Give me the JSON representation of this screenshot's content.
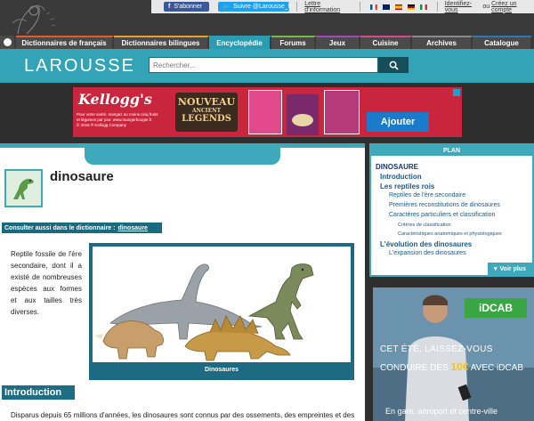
{
  "topbar": {
    "facebook_label": "S'abonner",
    "twitter_label": "Suivre @Larousse_fr",
    "newsletter_label": "Lettre d'information",
    "login_label": "Identifiez-vous",
    "or_label": "ou",
    "register_label": "Créez un compte"
  },
  "nav": {
    "items": [
      {
        "label": "Dictionnaires de français"
      },
      {
        "label": "Dictionnaires bilingues"
      },
      {
        "label": "Encyclopédie"
      },
      {
        "label": "Forums"
      },
      {
        "label": "Jeux"
      },
      {
        "label": "Cuisine"
      },
      {
        "label": "Archives"
      },
      {
        "label": "Catalogue"
      }
    ],
    "active_index": 2
  },
  "header": {
    "brand": "LAROUSSE",
    "search_placeholder": "Rechercher..."
  },
  "ad_banner": {
    "brand": "Kellogg's",
    "headline_1": "NOUVEAU",
    "headline_2": "ANCIENT",
    "headline_3": "LEGENDS",
    "small_text_1": "Pour votre santé, mangez au moins cinq fruits",
    "small_text_2": "et légumes par jour. www.mangerbouger.fr",
    "copyright": "© 2016 ® Kellogg Company",
    "cta": "Ajouter"
  },
  "article": {
    "title": "dinosaure",
    "see_also_label": "Consulter aussi dans le dictionnaire :",
    "see_also_link": "dinosaure",
    "lead": "Reptile fossile de l'ère secondaire, dont il a existé de nombreuses espèces aux formes et aux tailles très diverses.",
    "figure_caption": "Dinosaures",
    "section_heading": "Introduction",
    "body_start": "Disparus depuis 65 millions d'années, les dinosaures sont connus par des ossements, des empreintes et des"
  },
  "plan": {
    "heading": "PLAN",
    "items": [
      {
        "label": "DINOSAURE",
        "level": 0
      },
      {
        "label": "Introduction",
        "level": 1
      },
      {
        "label": "Les reptiles rois",
        "level": 1
      },
      {
        "label": "Reptiles de l'ère secondaire",
        "level": 2
      },
      {
        "label": "Premières reconstitutions de dinosaures",
        "level": 2
      },
      {
        "label": "Caractères particuliers et classification",
        "level": 2
      },
      {
        "label": "Critères de classification",
        "level": 3
      },
      {
        "label": "Caractéristiques anatomiques et physiologiques",
        "level": 3
      },
      {
        "label": "L'évolution des dinosaures",
        "level": 1
      },
      {
        "label": "L'expansion des dinosaures",
        "level": 2
      }
    ],
    "more_label": "Voir plus"
  },
  "side_ad": {
    "brand": "iDCAB",
    "line1": "CET ÉTÉ, LAISSEZ-VOUS",
    "line2_prefix": "CONDUIRE DÈS",
    "line2_price": "10€",
    "line2_suffix": "AVEC iDCAB",
    "line3": "En gare, aéroport et centre-ville"
  },
  "colors": {
    "accent": "#33a3b6",
    "dark_accent": "#1a6a80",
    "nav_bg": "#4a4a4a",
    "ad_red": "#c9263d"
  }
}
